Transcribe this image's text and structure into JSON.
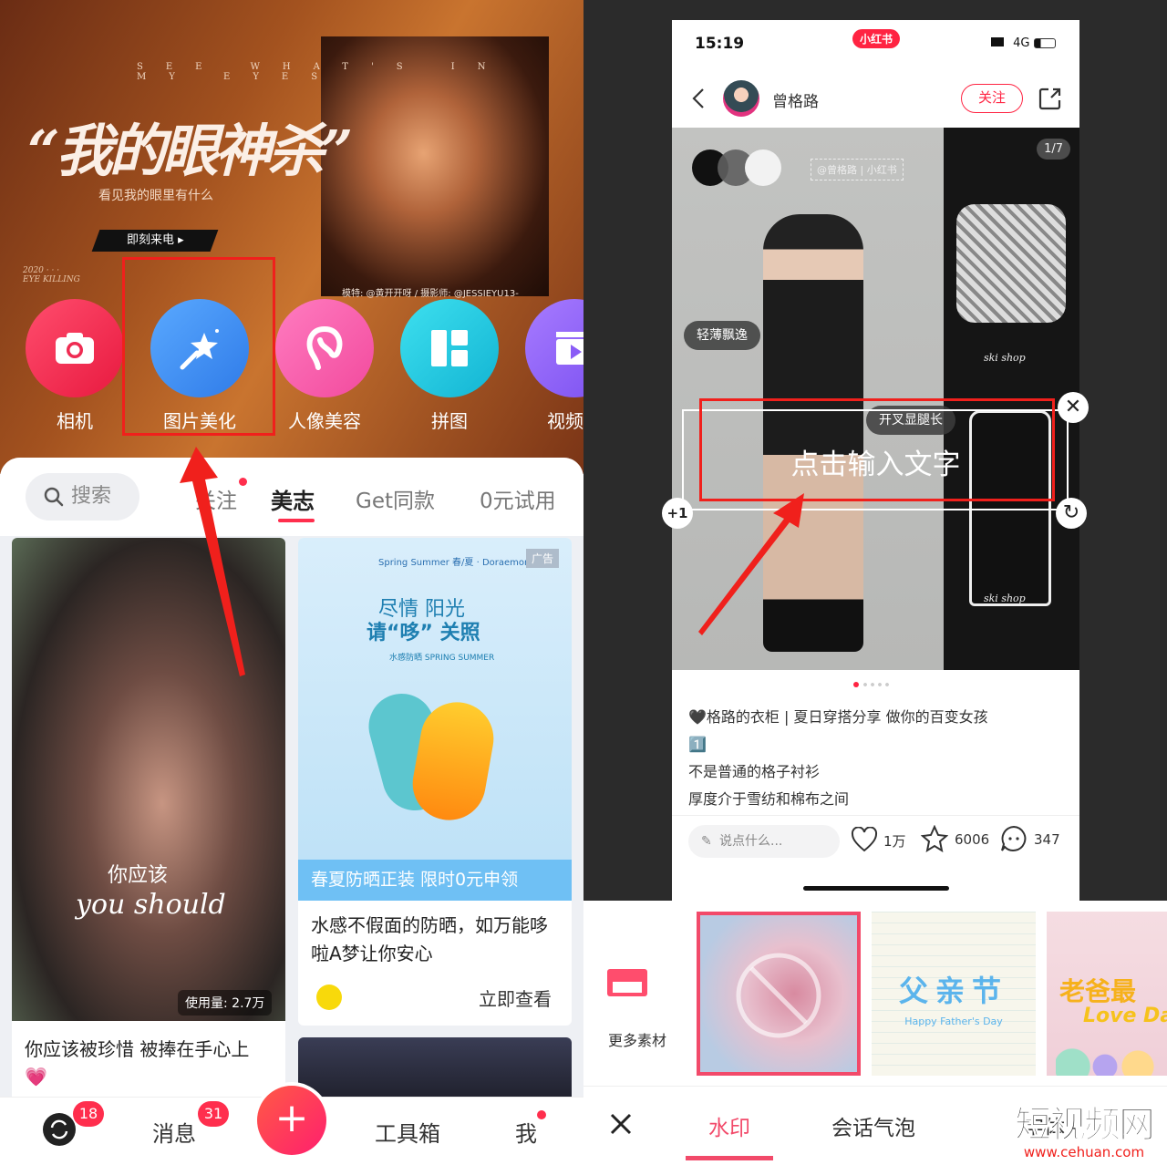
{
  "left_app": {
    "banner": {
      "tagline": "SEE WHAT'S IN MY EYES",
      "title": "“我的眼神杀”",
      "subtitle": "看见我的眼里有什么",
      "cta": "即刻来电 ▸",
      "year_note": "2020 · · ·",
      "eye_note": "EYE KILLING",
      "credit": "模特: @黄开开呀 / 摄影师: @JESSIEYU13-"
    },
    "tools": [
      {
        "label": "相机",
        "icon": "camera-icon",
        "color": "#f2335a"
      },
      {
        "label": "图片美化",
        "icon": "magic-wand-icon",
        "color": "#3d8ff5"
      },
      {
        "label": "人像美容",
        "icon": "face-icon",
        "color": "#fb5fae"
      },
      {
        "label": "拼图",
        "icon": "collage-icon",
        "color": "#1ec8e0"
      },
      {
        "label": "视频美",
        "icon": "video-icon",
        "color": "#8a5cf6"
      }
    ],
    "feed_tabs": {
      "search": "搜索",
      "items": [
        "关注",
        "美志",
        "Get同款",
        "0元试用"
      ],
      "active": "美志"
    },
    "cards": [
      {
        "overlay_cn": "你应该",
        "overlay_en": "you should",
        "usage": "使用量: 2.7万",
        "title": "你应该被珍惜 被捧在手心上💗"
      },
      {
        "ad_badge": "广告",
        "brand_line": "Spring Summer 春/夏 · Doraemon",
        "headline_1": "尽情 阳光",
        "headline_2": "请“哆” 关照",
        "product_line": "水感防晒 SPRING SUMMER",
        "banner": "春夏防晒正装 限时0元申领",
        "title": "水感不假面的防晒，如万能哆啦A梦让你安心",
        "action": "立即查看"
      }
    ],
    "bottom_nav": {
      "home_badge": "18",
      "messages": "消息",
      "messages_badge": "31",
      "add": "+",
      "toolbox": "工具箱",
      "me": "我"
    },
    "accent": "#ff2e4d"
  },
  "right_app": {
    "status": {
      "time": "15:19",
      "app_badge": "小红书",
      "network": "4G"
    },
    "header": {
      "author": "曾格路",
      "follow": "关注"
    },
    "image": {
      "watermark": "@曾格路 | 小红书",
      "counter": "1/7",
      "tag_1": "轻薄飘逸",
      "tag_2": "开叉显腿长",
      "text_placeholder": "点击输入文字",
      "plus_one": "+1",
      "brand_label": "ski shop"
    },
    "post": {
      "line_1": "🖤格路的衣柜 | 夏日穿搭分享 做你的百变女孩",
      "line_2": "1️⃣",
      "line_3": "不是普通的格子衬衫",
      "line_4": "厚度介于雪纺和棉布之间"
    },
    "actions": {
      "comment_placeholder": "说点什么...",
      "likes": "1万",
      "stars": "6006",
      "comments": "347"
    },
    "sticker_panel": {
      "more": "更多素材",
      "sticker_2_title": "父亲节",
      "sticker_2_sub": "Happy Father's Day",
      "sticker_3_title": "老爸最",
      "sticker_3_sub": "Love Dad"
    },
    "bottom_tabs": {
      "items": [
        "水印",
        "会话气泡",
        "字体"
      ],
      "active": "水印"
    }
  },
  "watermark_logo": {
    "text": "短视频网",
    "url_text": "www.cehuan.com"
  }
}
